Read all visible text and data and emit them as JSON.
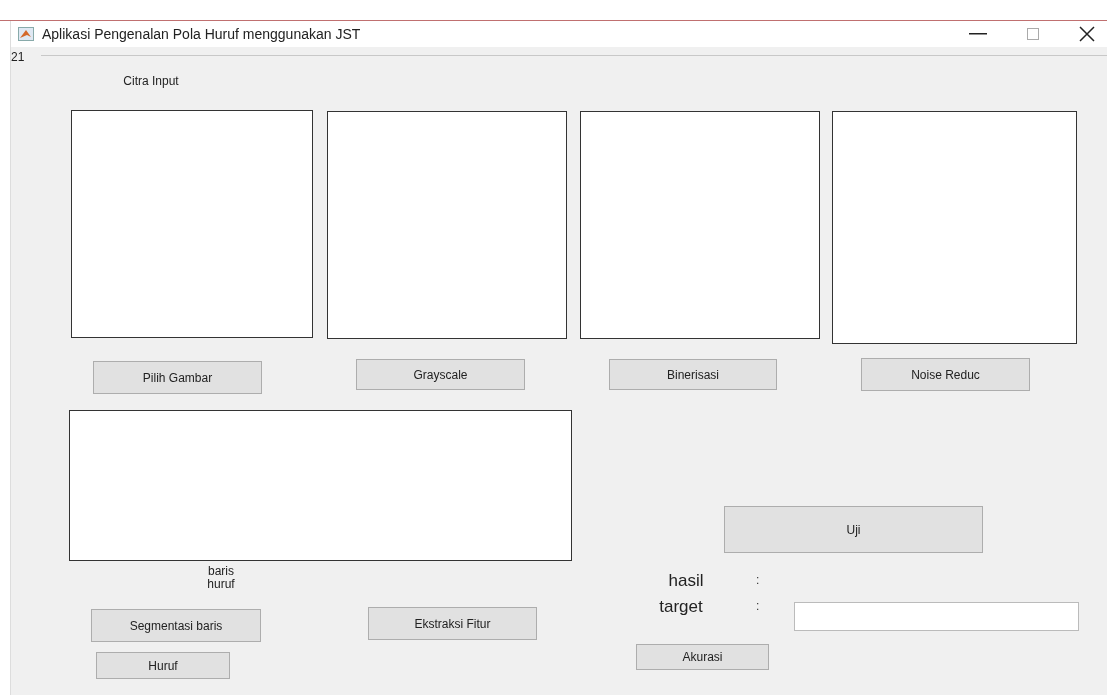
{
  "window": {
    "title": "Aplikasi Pengenalan Pola Huruf menggunakan JST"
  },
  "panel": {
    "title": "21"
  },
  "labels": [
    {
      "text": "Citra Input"
    },
    {
      "text": "baris\nhuruf"
    }
  ],
  "axes": [
    {
      "kind": "axes"
    },
    {
      "kind": "axes"
    },
    {
      "kind": "axes"
    },
    {
      "kind": "axes"
    },
    {
      "kind": "axes"
    }
  ],
  "buttons": [
    {
      "label": "Pilih Gambar"
    },
    {
      "label": "Grayscale"
    },
    {
      "label": "Binerisasi"
    },
    {
      "label": "Noise Reduc"
    },
    {
      "label": "Uji"
    },
    {
      "label": "Segmentasi baris"
    },
    {
      "label": "Ekstraksi Fitur"
    },
    {
      "label": "Huruf"
    },
    {
      "label": "Akurasi"
    }
  ],
  "results": [
    {
      "label": "hasil",
      "separator": ":"
    },
    {
      "label": "target",
      "separator": ":",
      "field": {
        "kind": "input"
      }
    }
  ]
}
